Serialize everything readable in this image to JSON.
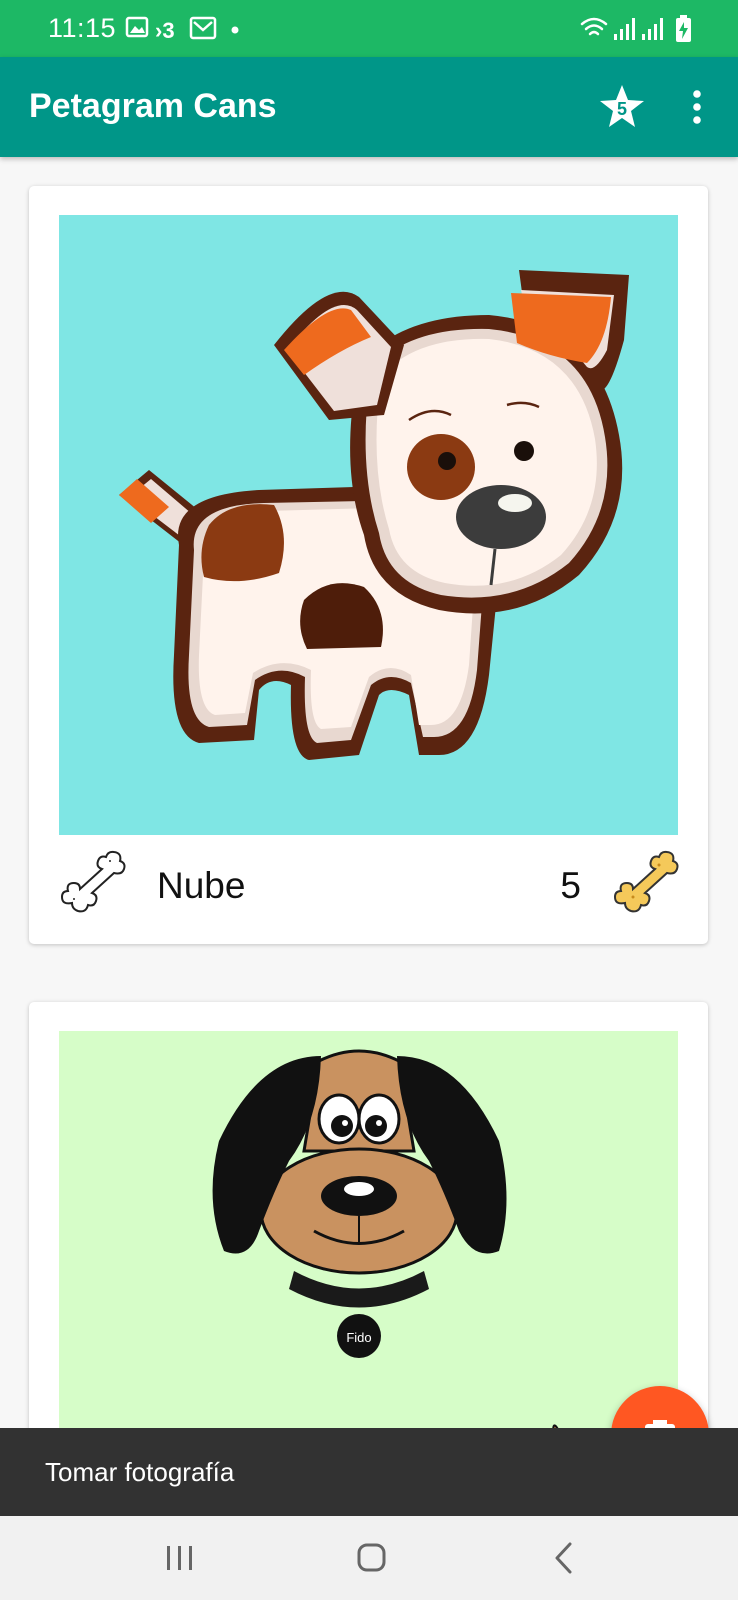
{
  "status_bar": {
    "time": "11:15",
    "left_icons": [
      "gallery-icon",
      "network-3g-icon",
      "gmail-icon",
      "dot-icon"
    ],
    "right_icons": [
      "wifi-icon",
      "signal-icon",
      "signal-icon",
      "battery-charging-icon"
    ]
  },
  "app_bar": {
    "title": "Petagram Cans",
    "favorites_badge": "5",
    "background": "#009688"
  },
  "pets": [
    {
      "name": "Nube",
      "likes": "5",
      "photo_background": "#7fe6e4",
      "illustration": "white-dog-with-brown-spots"
    },
    {
      "name": "Fido",
      "photo_background": "#d6fdc8",
      "illustration": "brown-dog-with-collar-tag"
    }
  ],
  "snackbar": {
    "message": "Tomar fotografía"
  },
  "fab": {
    "icon": "camera-icon",
    "color": "#ff5722"
  },
  "navigation": {
    "buttons": [
      "recents-icon",
      "home-icon",
      "back-icon"
    ]
  }
}
